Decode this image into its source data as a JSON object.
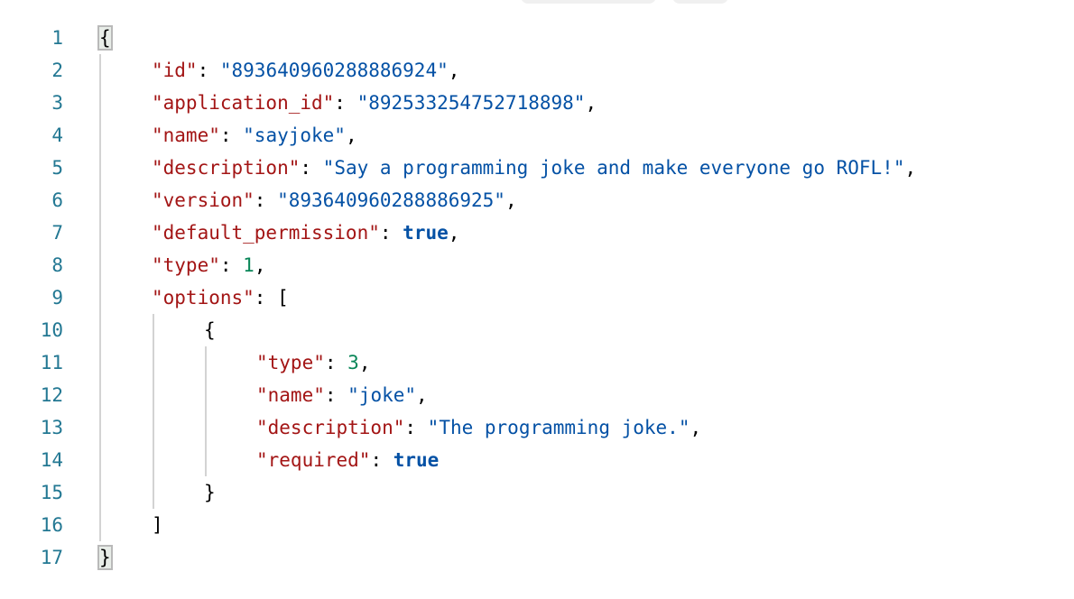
{
  "toolbar": {
    "buttons": [
      "",
      ""
    ]
  },
  "colors": {
    "key": "#a31515",
    "string": "#0451a5",
    "number": "#098658",
    "boolean": "#0451a5",
    "line_number": "#237893"
  },
  "lines": [
    {
      "n": "1",
      "indent": 0,
      "tokens": [
        {
          "t": "p",
          "v": "{"
        }
      ],
      "match": true
    },
    {
      "n": "2",
      "indent": 1,
      "tokens": [
        {
          "t": "k",
          "v": "\"id\""
        },
        {
          "t": "p",
          "v": ": "
        },
        {
          "t": "s",
          "v": "\"893640960288886924\""
        },
        {
          "t": "p",
          "v": ","
        }
      ]
    },
    {
      "n": "3",
      "indent": 1,
      "tokens": [
        {
          "t": "k",
          "v": "\"application_id\""
        },
        {
          "t": "p",
          "v": ": "
        },
        {
          "t": "s",
          "v": "\"892533254752718898\""
        },
        {
          "t": "p",
          "v": ","
        }
      ]
    },
    {
      "n": "4",
      "indent": 1,
      "tokens": [
        {
          "t": "k",
          "v": "\"name\""
        },
        {
          "t": "p",
          "v": ": "
        },
        {
          "t": "s",
          "v": "\"sayjoke\""
        },
        {
          "t": "p",
          "v": ","
        }
      ]
    },
    {
      "n": "5",
      "indent": 1,
      "tokens": [
        {
          "t": "k",
          "v": "\"description\""
        },
        {
          "t": "p",
          "v": ": "
        },
        {
          "t": "s",
          "v": "\"Say a programming joke and make everyone go ROFL!\""
        },
        {
          "t": "p",
          "v": ","
        }
      ]
    },
    {
      "n": "6",
      "indent": 1,
      "tokens": [
        {
          "t": "k",
          "v": "\"version\""
        },
        {
          "t": "p",
          "v": ": "
        },
        {
          "t": "s",
          "v": "\"893640960288886925\""
        },
        {
          "t": "p",
          "v": ","
        }
      ]
    },
    {
      "n": "7",
      "indent": 1,
      "tokens": [
        {
          "t": "k",
          "v": "\"default_permission\""
        },
        {
          "t": "p",
          "v": ": "
        },
        {
          "t": "b",
          "v": "true"
        },
        {
          "t": "p",
          "v": ","
        }
      ]
    },
    {
      "n": "8",
      "indent": 1,
      "tokens": [
        {
          "t": "k",
          "v": "\"type\""
        },
        {
          "t": "p",
          "v": ": "
        },
        {
          "t": "n",
          "v": "1"
        },
        {
          "t": "p",
          "v": ","
        }
      ]
    },
    {
      "n": "9",
      "indent": 1,
      "tokens": [
        {
          "t": "k",
          "v": "\"options\""
        },
        {
          "t": "p",
          "v": ": ["
        }
      ]
    },
    {
      "n": "10",
      "indent": 2,
      "tokens": [
        {
          "t": "p",
          "v": "{"
        }
      ]
    },
    {
      "n": "11",
      "indent": 3,
      "tokens": [
        {
          "t": "k",
          "v": "\"type\""
        },
        {
          "t": "p",
          "v": ": "
        },
        {
          "t": "n",
          "v": "3"
        },
        {
          "t": "p",
          "v": ","
        }
      ]
    },
    {
      "n": "12",
      "indent": 3,
      "tokens": [
        {
          "t": "k",
          "v": "\"name\""
        },
        {
          "t": "p",
          "v": ": "
        },
        {
          "t": "s",
          "v": "\"joke\""
        },
        {
          "t": "p",
          "v": ","
        }
      ]
    },
    {
      "n": "13",
      "indent": 3,
      "tokens": [
        {
          "t": "k",
          "v": "\"description\""
        },
        {
          "t": "p",
          "v": ": "
        },
        {
          "t": "s",
          "v": "\"The programming joke.\""
        },
        {
          "t": "p",
          "v": ","
        }
      ]
    },
    {
      "n": "14",
      "indent": 3,
      "tokens": [
        {
          "t": "k",
          "v": "\"required\""
        },
        {
          "t": "p",
          "v": ": "
        },
        {
          "t": "b",
          "v": "true"
        }
      ]
    },
    {
      "n": "15",
      "indent": 2,
      "tokens": [
        {
          "t": "p",
          "v": "}"
        }
      ]
    },
    {
      "n": "16",
      "indent": 1,
      "tokens": [
        {
          "t": "p",
          "v": "]"
        }
      ]
    },
    {
      "n": "17",
      "indent": 0,
      "tokens": [
        {
          "t": "p",
          "v": "}"
        }
      ],
      "match": true
    }
  ]
}
